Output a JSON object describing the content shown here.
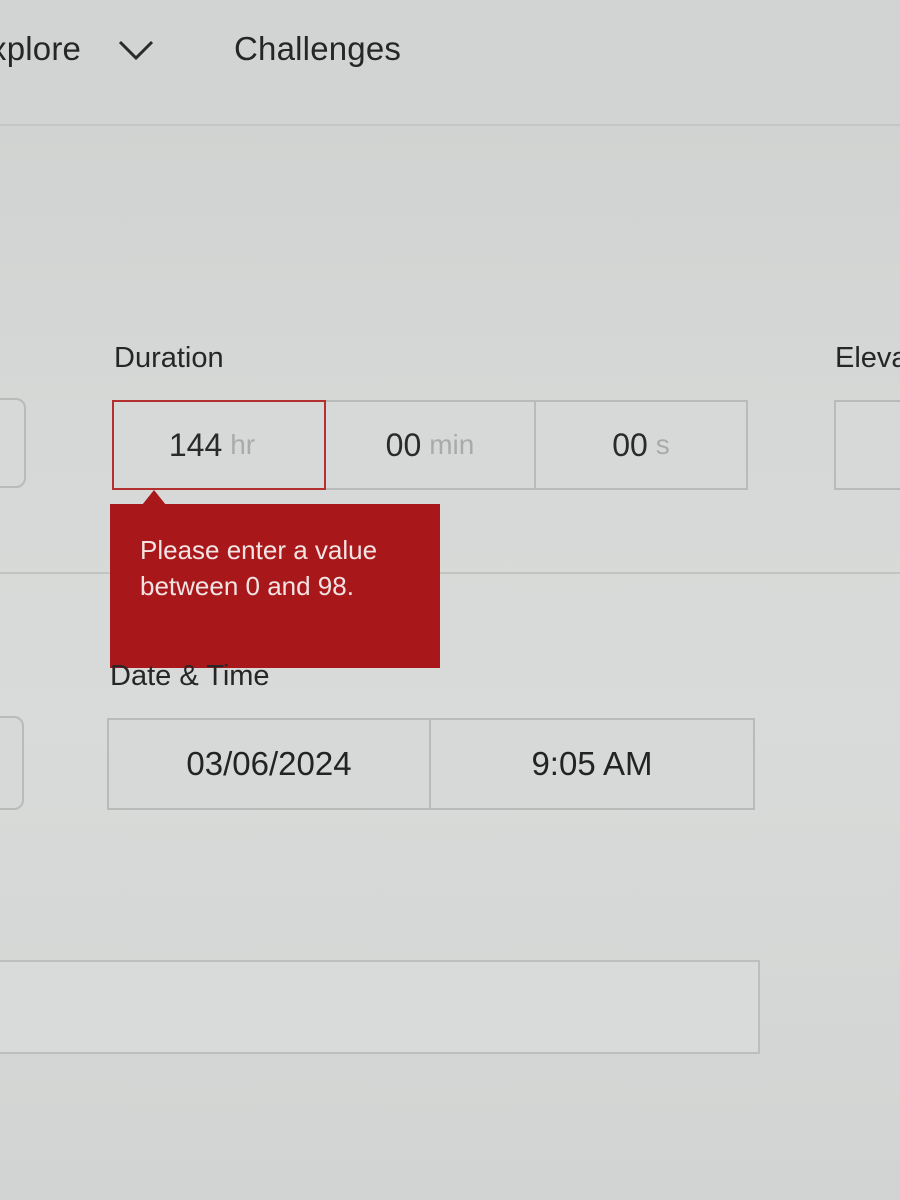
{
  "nav": {
    "explore_label": "xplore",
    "challenges_label": "Challenges"
  },
  "duration": {
    "label": "Duration",
    "hours_value": "144",
    "hours_unit": "hr",
    "minutes_value": "00",
    "minutes_unit": "min",
    "seconds_value": "00",
    "seconds_unit": "s"
  },
  "error": {
    "message": "Please enter a value between 0 and 98.",
    "color": "#a8181b"
  },
  "elevation": {
    "label": "Eleva"
  },
  "datetime": {
    "label": "Date & Time",
    "date": "03/06/2024",
    "time": "9:05 AM"
  }
}
